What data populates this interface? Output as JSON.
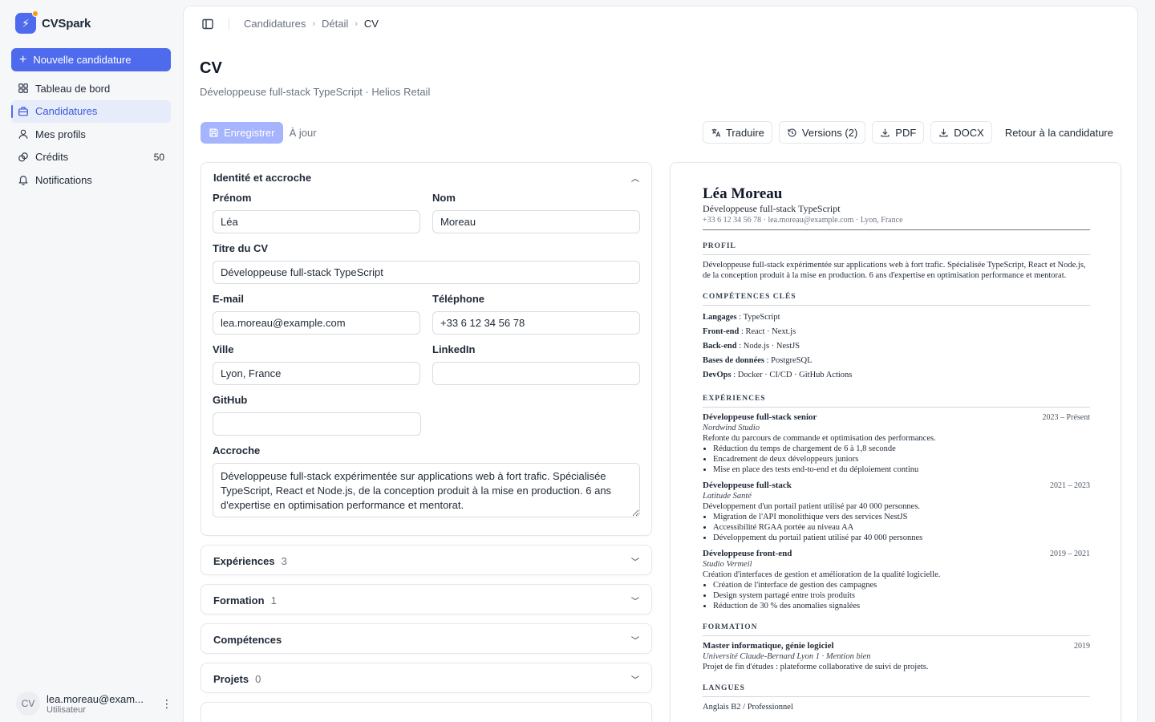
{
  "brand": {
    "name": "CVSpark"
  },
  "sidebar": {
    "new_label": "Nouvelle candidature",
    "items": [
      {
        "label": "Tableau de bord",
        "icon": "dashboard-icon"
      },
      {
        "label": "Candidatures",
        "icon": "briefcase-icon",
        "active": true
      },
      {
        "label": "Mes profils",
        "icon": "user-icon"
      },
      {
        "label": "Crédits",
        "icon": "coins-icon",
        "count": "50"
      },
      {
        "label": "Notifications",
        "icon": "bell-icon"
      }
    ],
    "user": {
      "initials": "CV",
      "email": "lea.moreau@exam...",
      "role": "Utilisateur"
    }
  },
  "breadcrumb": [
    "Candidatures",
    "Détail",
    "CV"
  ],
  "page": {
    "title": "CV",
    "subtitle": "Développeuse full-stack TypeScript · Helios Retail"
  },
  "toolbar": {
    "save_label": "Enregistrer",
    "status": "À jour",
    "translate_label": "Traduire",
    "versions_label": "Versions (2)",
    "pdf_label": "PDF",
    "docx_label": "DOCX",
    "back_label": "Retour à la candidature"
  },
  "form": {
    "section_title": "Identité et accroche",
    "first_name": {
      "label": "Prénom",
      "value": "Léa"
    },
    "last_name": {
      "label": "Nom",
      "value": "Moreau"
    },
    "cv_title": {
      "label": "Titre du CV",
      "value": "Développeuse full-stack TypeScript"
    },
    "email": {
      "label": "E-mail",
      "value": "lea.moreau@example.com"
    },
    "phone": {
      "label": "Téléphone",
      "value": "+33 6 12 34 56 78"
    },
    "city": {
      "label": "Ville",
      "value": "Lyon, France"
    },
    "linkedin": {
      "label": "LinkedIn",
      "value": ""
    },
    "github": {
      "label": "GitHub",
      "value": ""
    },
    "hook": {
      "label": "Accroche",
      "value": "Développeuse full-stack expérimentée sur applications web à fort trafic. Spécialisée TypeScript, React et Node.js, de la conception produit à la mise en production. 6 ans d'expertise en optimisation performance et mentorat."
    },
    "sections": [
      {
        "label": "Expériences",
        "count": "3"
      },
      {
        "label": "Formation",
        "count": "1"
      },
      {
        "label": "Compétences",
        "count": ""
      },
      {
        "label": "Projets",
        "count": "0"
      }
    ]
  },
  "preview": {
    "name": "Léa Moreau",
    "title": "Développeuse full-stack TypeScript",
    "contact": "+33 6 12 34 56 78 · lea.moreau@example.com · Lyon, France",
    "profile_heading": "Profil",
    "profile_text": "Développeuse full-stack expérimentée sur applications web à fort trafic. Spécialisée TypeScript, React et Node.js, de la conception produit à la mise en production. 6 ans d'expertise en optimisation performance et mentorat.",
    "skills_heading": "Compétences clés",
    "skills": [
      {
        "k": "Langages",
        "v": " : TypeScript"
      },
      {
        "k": "Front-end",
        "v": " : React · Next.js"
      },
      {
        "k": "Back-end",
        "v": " : Node.js · NestJS"
      },
      {
        "k": "Bases de données",
        "v": " : PostgreSQL"
      },
      {
        "k": "DevOps",
        "v": " : Docker · CI/CD · GitHub Actions"
      }
    ],
    "exp_heading": "Expériences",
    "experiences": [
      {
        "title": "Développeuse full-stack senior",
        "dates": "2023 – Présent",
        "company": "Nordwind Studio",
        "desc": "Refonte du parcours de commande et optimisation des performances.",
        "bullets": [
          "Réduction du temps de chargement de 6 à 1,8 seconde",
          "Encadrement de deux développeurs juniors",
          "Mise en place des tests end-to-end et du déploiement continu"
        ]
      },
      {
        "title": "Développeuse full-stack",
        "dates": "2021 – 2023",
        "company": "Latitude Santé",
        "desc": "Développement d'un portail patient utilisé par 40 000 personnes.",
        "bullets": [
          "Migration de l'API monolithique vers des services NestJS",
          "Accessibilité RGAA portée au niveau AA",
          "Développement du portail patient utilisé par 40 000 personnes"
        ]
      },
      {
        "title": "Développeuse front-end",
        "dates": "2019 – 2021",
        "company": "Studio Vermeil",
        "desc": "Création d'interfaces de gestion et amélioration de la qualité logicielle.",
        "bullets": [
          "Création de l'interface de gestion des campagnes",
          "Design system partagé entre trois produits",
          "Réduction de 30 % des anomalies signalées"
        ]
      }
    ],
    "edu_heading": "Formation",
    "education": {
      "title": "Master informatique, génie logiciel",
      "date": "2019",
      "school": "Université Claude-Bernard Lyon 1 · Mention bien",
      "desc": "Projet de fin d'études : plateforme collaborative de suivi de projets."
    },
    "lang_heading": "Langues",
    "languages": "Anglais B2 / Professionnel"
  }
}
